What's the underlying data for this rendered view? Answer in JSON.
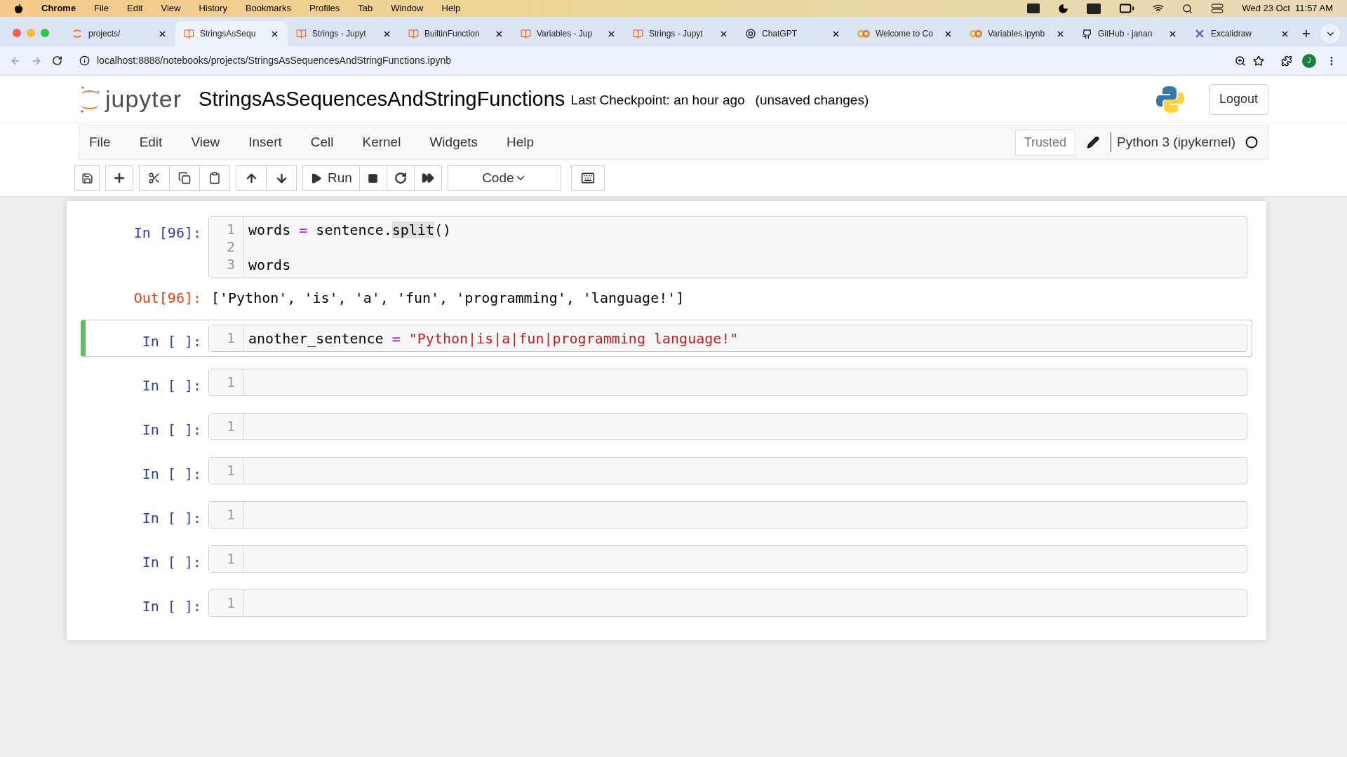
{
  "mac_menu": {
    "app": "Chrome",
    "items": [
      "File",
      "Edit",
      "View",
      "History",
      "Bookmarks",
      "Profiles",
      "Tab",
      "Window",
      "Help"
    ],
    "clock": "Wed 23 Oct  11:57 AM"
  },
  "tabs": [
    {
      "title": "projects/",
      "kind": "jupyter",
      "selected": false
    },
    {
      "title": "StringsAsSequ",
      "kind": "notebook",
      "selected": true
    },
    {
      "title": "Strings - Jupyt",
      "kind": "notebook",
      "selected": false
    },
    {
      "title": "BuiltinFunction",
      "kind": "notebook",
      "selected": false
    },
    {
      "title": "Variables - Jup",
      "kind": "notebook",
      "selected": false
    },
    {
      "title": "Strings - Jupyt",
      "kind": "notebook",
      "selected": false
    },
    {
      "title": "ChatGPT",
      "kind": "chat",
      "selected": false
    },
    {
      "title": "Welcome to Co",
      "kind": "colab",
      "selected": false
    },
    {
      "title": "Variables.ipynb",
      "kind": "colab",
      "selected": false
    },
    {
      "title": "GitHub - janan",
      "kind": "github",
      "selected": false
    },
    {
      "title": "Excalidraw",
      "kind": "excalidraw",
      "selected": false
    }
  ],
  "address": "localhost:8888/notebooks/projects/StringsAsSequencesAndStringFunctions.ipynb",
  "profile_initial": "J",
  "notebook": {
    "logo_text": "jupyter",
    "name": "StringsAsSequencesAndStringFunctions",
    "checkpoint": "Last Checkpoint: an hour ago",
    "unsaved": "(unsaved changes)",
    "logout": "Logout"
  },
  "menu": [
    "File",
    "Edit",
    "View",
    "Insert",
    "Cell",
    "Kernel",
    "Widgets",
    "Help"
  ],
  "trusted": "Trusted",
  "kernel": "Python 3 (ipykernel)",
  "toolbar": {
    "run": "Run",
    "cell_type": "Code"
  },
  "cells": [
    {
      "prompt": "In [96]:",
      "selected": false,
      "lines": [
        {
          "number": "1",
          "tokens": [
            {
              "text": "words ",
              "kind": "plain"
            },
            {
              "text": "=",
              "kind": "operator"
            },
            {
              "text": " sentence.",
              "kind": "plain"
            },
            {
              "text": "split",
              "kind": "match"
            },
            {
              "text": "()",
              "kind": "plain"
            }
          ]
        },
        {
          "number": "2"
        },
        {
          "number": "3",
          "tokens": [
            {
              "text": "words",
              "kind": "plain"
            }
          ]
        }
      ],
      "output": {
        "prompt": "Out[96]:",
        "text": "['Python', 'is', 'a', 'fun', 'programming', 'language!']"
      }
    },
    {
      "prompt": "In [ ]:",
      "selected": true,
      "lines": [
        {
          "number": "1",
          "tokens": [
            {
              "text": "another_sentence ",
              "kind": "plain"
            },
            {
              "text": "=",
              "kind": "operator"
            },
            {
              "text": " \"Python|is|a|fun|programming language!\"",
              "kind": "string"
            }
          ]
        }
      ]
    },
    {
      "prompt": "In [ ]:",
      "selected": false,
      "lines": [
        {
          "number": "1"
        }
      ]
    },
    {
      "prompt": "In [ ]:",
      "selected": false,
      "lines": [
        {
          "number": "1"
        }
      ]
    },
    {
      "prompt": "In [ ]:",
      "selected": false,
      "lines": [
        {
          "number": "1"
        }
      ]
    },
    {
      "prompt": "In [ ]:",
      "selected": false,
      "lines": [
        {
          "number": "1"
        }
      ]
    },
    {
      "prompt": "In [ ]:",
      "selected": false,
      "lines": [
        {
          "number": "1"
        }
      ]
    },
    {
      "prompt": "In [ ]:",
      "selected": false,
      "lines": [
        {
          "number": "1"
        }
      ]
    }
  ]
}
